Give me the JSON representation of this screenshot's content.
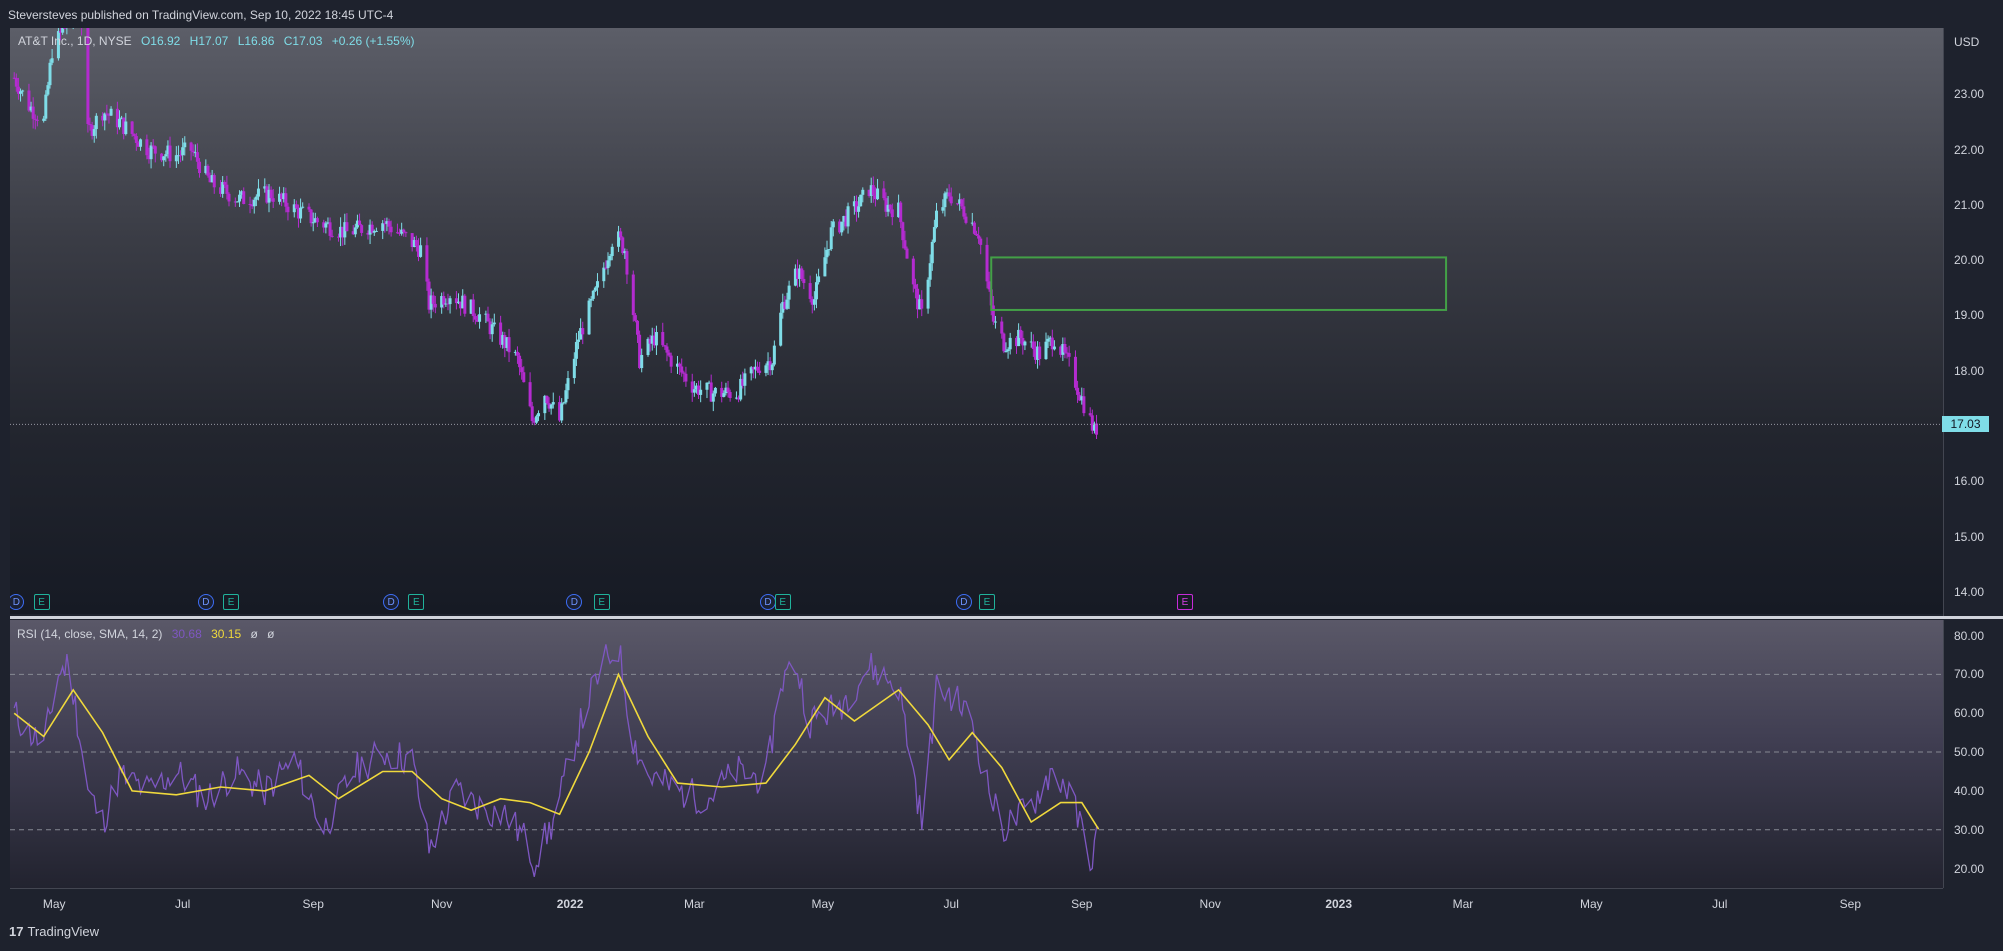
{
  "header": {
    "publish_text": "Steversteves published on TradingView.com, Sep 10, 2022 18:45 UTC-4"
  },
  "legend": {
    "symbol": "AT&T Inc., 1D, NYSE",
    "open": "O16.92",
    "high": "H17.07",
    "low": "L16.86",
    "close": "C17.03",
    "change": "+0.26 (+1.55%)"
  },
  "rsi_legend": {
    "label": "RSI (14, close, SMA, 14, 2)",
    "rsi_value": "30.68",
    "sma_value": "30.15",
    "extra1": "ø",
    "extra2": "ø"
  },
  "currency": "USD",
  "last_price": "17.03",
  "colors": {
    "up": "#7fdde8",
    "down": "#b42bd0",
    "rsi_line": "#7e57c2",
    "rsi_sma": "#f0d93c",
    "zone": "#43a047",
    "price_line": "#9598a1"
  },
  "price_axis": [
    "23.00",
    "22.00",
    "21.00",
    "20.00",
    "19.00",
    "18.00",
    "17.00",
    "16.00",
    "15.00",
    "14.00"
  ],
  "rsi_axis": [
    "80.00",
    "70.00",
    "60.00",
    "50.00",
    "40.00",
    "30.00",
    "20.00"
  ],
  "time_axis": [
    {
      "label": "May",
      "bold": false
    },
    {
      "label": "Jul",
      "bold": false
    },
    {
      "label": "Sep",
      "bold": false
    },
    {
      "label": "Nov",
      "bold": false
    },
    {
      "label": "2022",
      "bold": true
    },
    {
      "label": "Mar",
      "bold": false
    },
    {
      "label": "May",
      "bold": false
    },
    {
      "label": "Jul",
      "bold": false
    },
    {
      "label": "Sep",
      "bold": false
    },
    {
      "label": "Nov",
      "bold": false
    },
    {
      "label": "2023",
      "bold": true
    },
    {
      "label": "Mar",
      "bold": false
    },
    {
      "label": "May",
      "bold": false
    },
    {
      "label": "Jul",
      "bold": false
    },
    {
      "label": "Sep",
      "bold": false
    }
  ],
  "markers": [
    {
      "type": "D",
      "label": "D"
    },
    {
      "type": "E",
      "label": "E"
    },
    {
      "type": "D",
      "label": "D"
    },
    {
      "type": "E",
      "label": "E"
    },
    {
      "type": "D",
      "label": "D"
    },
    {
      "type": "E",
      "label": "E"
    },
    {
      "type": "D",
      "label": "D"
    },
    {
      "type": "E",
      "label": "E"
    },
    {
      "type": "D",
      "label": "D"
    },
    {
      "type": "E",
      "label": "E"
    },
    {
      "type": "D",
      "label": "D"
    },
    {
      "type": "E",
      "label": "E"
    },
    {
      "type": "E2",
      "label": "E"
    }
  ],
  "footer": {
    "brand": "TradingView",
    "logo_glyph": "17"
  },
  "chart_data": [
    {
      "type": "candlestick",
      "title": "AT&T Inc., 1D, NYSE",
      "ylim": [
        13.6,
        24.2
      ],
      "x_range": [
        "2021-04-10",
        "2023-10-15"
      ],
      "grid": false,
      "price_points": [
        [
          "2021-04-12",
          23.3
        ],
        [
          "2021-04-19",
          22.8
        ],
        [
          "2021-04-26",
          22.5
        ],
        [
          "2021-04-30",
          23.8
        ],
        [
          "2021-05-10",
          24.5
        ],
        [
          "2021-05-14",
          24.3
        ],
        [
          "2021-05-17",
          22.3
        ],
        [
          "2021-05-24",
          22.7
        ],
        [
          "2021-06-01",
          22.5
        ],
        [
          "2021-06-15",
          22.0
        ],
        [
          "2021-06-28",
          21.9
        ],
        [
          "2021-07-05",
          22.0
        ],
        [
          "2021-07-14",
          21.4
        ],
        [
          "2021-07-28",
          21.1
        ],
        [
          "2021-08-12",
          21.2
        ],
        [
          "2021-08-24",
          20.9
        ],
        [
          "2021-09-03",
          20.7
        ],
        [
          "2021-09-17",
          20.5
        ],
        [
          "2021-10-04",
          20.7
        ],
        [
          "2021-10-15",
          20.4
        ],
        [
          "2021-10-22",
          20.2
        ],
        [
          "2021-10-26",
          19.2
        ],
        [
          "2021-11-05",
          19.4
        ],
        [
          "2021-11-19",
          19.0
        ],
        [
          "2021-12-01",
          18.5
        ],
        [
          "2021-12-07",
          18.2
        ],
        [
          "2021-12-14",
          17.1
        ],
        [
          "2021-12-20",
          17.6
        ],
        [
          "2021-12-27",
          17.1
        ],
        [
          "2022-01-05",
          18.6
        ],
        [
          "2022-01-14",
          19.5
        ],
        [
          "2022-01-22",
          20.5
        ],
        [
          "2022-01-27",
          20.2
        ],
        [
          "2022-02-03",
          18.2
        ],
        [
          "2022-02-10",
          18.6
        ],
        [
          "2022-02-20",
          18.1
        ],
        [
          "2022-03-01",
          17.7
        ],
        [
          "2022-03-10",
          17.6
        ],
        [
          "2022-03-21",
          17.6
        ],
        [
          "2022-04-01",
          18.1
        ],
        [
          "2022-04-07",
          18.2
        ],
        [
          "2022-04-12",
          19.2
        ],
        [
          "2022-04-19",
          19.8
        ],
        [
          "2022-04-27",
          19.3
        ],
        [
          "2022-05-05",
          20.5
        ],
        [
          "2022-05-18",
          21.0
        ],
        [
          "2022-05-23",
          21.3
        ],
        [
          "2022-05-31",
          21.0
        ],
        [
          "2022-06-06",
          20.9
        ],
        [
          "2022-06-13",
          19.5
        ],
        [
          "2022-06-17",
          19.0
        ],
        [
          "2022-06-24",
          20.8
        ],
        [
          "2022-06-30",
          21.2
        ],
        [
          "2022-07-07",
          20.9
        ],
        [
          "2022-07-14",
          20.5
        ],
        [
          "2022-07-21",
          18.9
        ],
        [
          "2022-07-26",
          18.5
        ],
        [
          "2022-08-03",
          18.6
        ],
        [
          "2022-08-12",
          18.3
        ],
        [
          "2022-08-19",
          18.6
        ],
        [
          "2022-08-26",
          18.1
        ],
        [
          "2022-09-01",
          17.5
        ],
        [
          "2022-09-07",
          16.9
        ],
        [
          "2022-09-09",
          17.03
        ]
      ],
      "last_price": 17.03,
      "zone": {
        "x0": "2022-07-20",
        "x1": "2023-02-21",
        "y_top": 20.05,
        "y_bottom": 19.1
      },
      "price_line": 17.03
    },
    {
      "type": "line",
      "title": "RSI (14, close, SMA, 14, 2)",
      "ylim": [
        15,
        84
      ],
      "reference_lines": [
        70,
        50,
        30
      ],
      "series": [
        {
          "name": "RSI",
          "values": [
            [
              "2021-04-12",
              60
            ],
            [
              "2021-04-19",
              55
            ],
            [
              "2021-04-26",
              52
            ],
            [
              "2021-05-03",
              70
            ],
            [
              "2021-05-08",
              73
            ],
            [
              "2021-05-17",
              40
            ],
            [
              "2021-05-24",
              32
            ],
            [
              "2021-06-01",
              44
            ],
            [
              "2021-06-15",
              40
            ],
            [
              "2021-06-28",
              45
            ],
            [
              "2021-07-12",
              38
            ],
            [
              "2021-07-26",
              45
            ],
            [
              "2021-08-09",
              40
            ],
            [
              "2021-08-23",
              48
            ],
            [
              "2021-09-06",
              30
            ],
            [
              "2021-09-20",
              45
            ],
            [
              "2021-10-04",
              50
            ],
            [
              "2021-10-18",
              48
            ],
            [
              "2021-10-26",
              25
            ],
            [
              "2021-11-08",
              40
            ],
            [
              "2021-11-22",
              35
            ],
            [
              "2021-12-01",
              34
            ],
            [
              "2021-12-10",
              28
            ],
            [
              "2021-12-15",
              22
            ],
            [
              "2021-12-24",
              32
            ],
            [
              "2022-01-03",
              52
            ],
            [
              "2022-01-10",
              64
            ],
            [
              "2022-01-17",
              73
            ],
            [
              "2022-01-24",
              77
            ],
            [
              "2022-01-31",
              53
            ],
            [
              "2022-02-07",
              44
            ],
            [
              "2022-02-21",
              40
            ],
            [
              "2022-03-07",
              38
            ],
            [
              "2022-03-21",
              45
            ],
            [
              "2022-04-04",
              43
            ],
            [
              "2022-04-11",
              68
            ],
            [
              "2022-04-18",
              73
            ],
            [
              "2022-04-25",
              58
            ],
            [
              "2022-05-09",
              62
            ],
            [
              "2022-05-23",
              72
            ],
            [
              "2022-06-06",
              67
            ],
            [
              "2022-06-13",
              45
            ],
            [
              "2022-06-17",
              32
            ],
            [
              "2022-06-24",
              66
            ],
            [
              "2022-07-01",
              65
            ],
            [
              "2022-07-11",
              58
            ],
            [
              "2022-07-18",
              42
            ],
            [
              "2022-07-25",
              30
            ],
            [
              "2022-08-08",
              36
            ],
            [
              "2022-08-17",
              45
            ],
            [
              "2022-08-24",
              42
            ],
            [
              "2022-09-01",
              30
            ],
            [
              "2022-09-06",
              22
            ],
            [
              "2022-09-09",
              30.68
            ]
          ]
        },
        {
          "name": "SMA",
          "values": [
            [
              "2021-04-12",
              60
            ],
            [
              "2021-04-26",
              54
            ],
            [
              "2021-05-10",
              66
            ],
            [
              "2021-05-24",
              55
            ],
            [
              "2021-06-07",
              40
            ],
            [
              "2021-06-28",
              39
            ],
            [
              "2021-07-19",
              41
            ],
            [
              "2021-08-09",
              40
            ],
            [
              "2021-08-30",
              44
            ],
            [
              "2021-09-13",
              38
            ],
            [
              "2021-10-04",
              45
            ],
            [
              "2021-10-18",
              45
            ],
            [
              "2021-11-01",
              38
            ],
            [
              "2021-11-15",
              35
            ],
            [
              "2021-11-29",
              38
            ],
            [
              "2021-12-13",
              37
            ],
            [
              "2021-12-27",
              34
            ],
            [
              "2022-01-10",
              50
            ],
            [
              "2022-01-24",
              70
            ],
            [
              "2022-02-07",
              54
            ],
            [
              "2022-02-21",
              42
            ],
            [
              "2022-03-14",
              41
            ],
            [
              "2022-04-04",
              42
            ],
            [
              "2022-04-18",
              52
            ],
            [
              "2022-05-02",
              64
            ],
            [
              "2022-05-16",
              58
            ],
            [
              "2022-06-06",
              66
            ],
            [
              "2022-06-20",
              57
            ],
            [
              "2022-06-30",
              48
            ],
            [
              "2022-07-11",
              55
            ],
            [
              "2022-07-25",
              46
            ],
            [
              "2022-08-08",
              32
            ],
            [
              "2022-08-22",
              37
            ],
            [
              "2022-09-01",
              37
            ],
            [
              "2022-09-09",
              30.15
            ]
          ]
        }
      ]
    }
  ]
}
